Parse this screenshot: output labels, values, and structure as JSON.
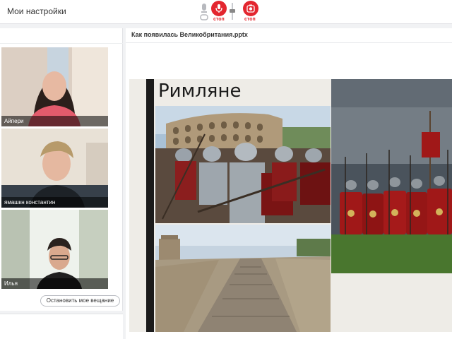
{
  "header": {
    "title": "Мои настройки",
    "stop_label_1": "стоп",
    "stop_label_2": "стоп"
  },
  "participants": [
    {
      "name": "Айпери"
    },
    {
      "name": "ямашкн константин"
    },
    {
      "name": "Илья"
    }
  ],
  "controls": {
    "stop_broadcast": "Остановить мое вещание"
  },
  "presentation": {
    "file_name": "Как появилась Великобритания.pptx",
    "slide_title": "Римляне"
  },
  "colors": {
    "accent_red": "#e3262f"
  }
}
